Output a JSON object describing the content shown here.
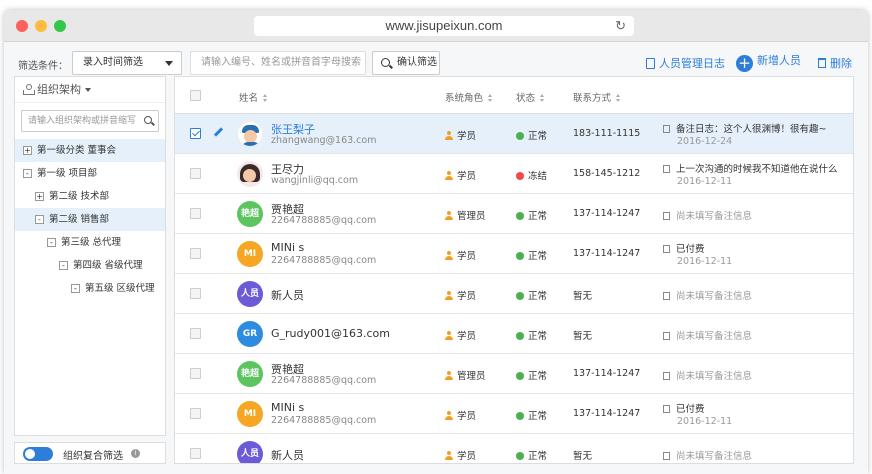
{
  "browser": {
    "url": "www.jisupeixun.com"
  },
  "toolbar": {
    "filter_label": "筛选条件：",
    "filter_select": "录入时间筛选",
    "search_placeholder": "请输入编号、姓名或拼音首字母搜索",
    "confirm_label": "确认筛选",
    "log_label": "人员管理日志",
    "add_label": "新增人员",
    "delete_label": "删除"
  },
  "sidebar": {
    "title": "组织架构",
    "search_placeholder": "请输入组织架构或拼音缩写",
    "tree": [
      {
        "toggle": "+",
        "label": "第一级分类 董事会",
        "level": 0,
        "selected": true
      },
      {
        "toggle": "-",
        "label": "第一级 项目部",
        "level": 0,
        "selected": false
      },
      {
        "toggle": "+",
        "label": "第二级 技术部",
        "level": 1,
        "selected": false
      },
      {
        "toggle": "-",
        "label": "第二级 销售部",
        "level": 1,
        "selected": true
      },
      {
        "toggle": "-",
        "label": "第三级 总代理",
        "level": 2,
        "selected": false
      },
      {
        "toggle": "-",
        "label": "第四级 省级代理",
        "level": 3,
        "selected": false
      },
      {
        "toggle": "-",
        "label": "第五级 区级代理",
        "level": 4,
        "selected": false
      }
    ],
    "bottom_label": "组织复合筛选",
    "info_icon": "i"
  },
  "table": {
    "columns": {
      "name": "姓名",
      "role": "系统角色",
      "status": "状态",
      "contact": "联系方式"
    },
    "rows": [
      {
        "avatar": "photo1",
        "avatar_text": "",
        "name": "张王梨子",
        "email": "zhangwang@163.com",
        "role": "学员",
        "status": "正常",
        "status_color": "#4caf50",
        "phone": "183-111-1115",
        "note": "备注日志：这个人很渊博！很有趣~",
        "note_date": "2016-12-24",
        "selected": true
      },
      {
        "avatar": "photo2",
        "avatar_text": "",
        "name": "王尽力",
        "email": "wangjinli@qq.com",
        "role": "学员",
        "status": "冻结",
        "status_color": "#f04848",
        "phone": "158-145-1212",
        "note": "上一次沟通的时候我不知道他在说什么",
        "note_date": "2016-12-11",
        "selected": false
      },
      {
        "avatar": "",
        "avatar_text": "艳超",
        "avatar_color": "#5cc55f",
        "name": "贾艳超",
        "email": "2264788885@qq.com",
        "role": "管理员",
        "status": "正常",
        "status_color": "#4caf50",
        "phone": "137-114-1247",
        "note": "尚未填写备注信息",
        "note_date": "",
        "selected": false
      },
      {
        "avatar": "",
        "avatar_text": "MI",
        "avatar_color": "#f5a623",
        "name": "MINi s",
        "email": "2264788885@qq.com",
        "role": "学员",
        "status": "正常",
        "status_color": "#4caf50",
        "phone": "137-114-1247",
        "note": "已付费",
        "note_date": "2016-12-11",
        "selected": false
      },
      {
        "avatar": "",
        "avatar_text": "人员",
        "avatar_color": "#6b5bd6",
        "name": "新人员",
        "email": "",
        "role": "学员",
        "status": "正常",
        "status_color": "#4caf50",
        "phone": "暂无",
        "note": "尚未填写备注信息",
        "note_date": "",
        "selected": false
      },
      {
        "avatar": "",
        "avatar_text": "GR",
        "avatar_color": "#2d8be0",
        "name": "G_rudy001@163.com",
        "email": "",
        "role": "学员",
        "status": "正常",
        "status_color": "#4caf50",
        "phone": "暂无",
        "note": "尚未填写备注信息",
        "note_date": "",
        "selected": false
      },
      {
        "avatar": "",
        "avatar_text": "艳超",
        "avatar_color": "#5cc55f",
        "name": "贾艳超",
        "email": "2264788885@qq.com",
        "role": "管理员",
        "status": "正常",
        "status_color": "#4caf50",
        "phone": "137-114-1247",
        "note": "尚未填写备注信息",
        "note_date": "",
        "selected": false
      },
      {
        "avatar": "",
        "avatar_text": "MI",
        "avatar_color": "#f5a623",
        "name": "MINi s",
        "email": "2264788885@qq.com",
        "role": "学员",
        "status": "正常",
        "status_color": "#4caf50",
        "phone": "137-114-1247",
        "note": "已付费",
        "note_date": "2016-12-11",
        "selected": false
      },
      {
        "avatar": "",
        "avatar_text": "人员",
        "avatar_color": "#6b5bd6",
        "name": "新人员",
        "email": "",
        "role": "学员",
        "status": "正常",
        "status_color": "#4caf50",
        "phone": "暂无",
        "note": "尚未填写备注信息",
        "note_date": "",
        "selected": false
      }
    ]
  }
}
